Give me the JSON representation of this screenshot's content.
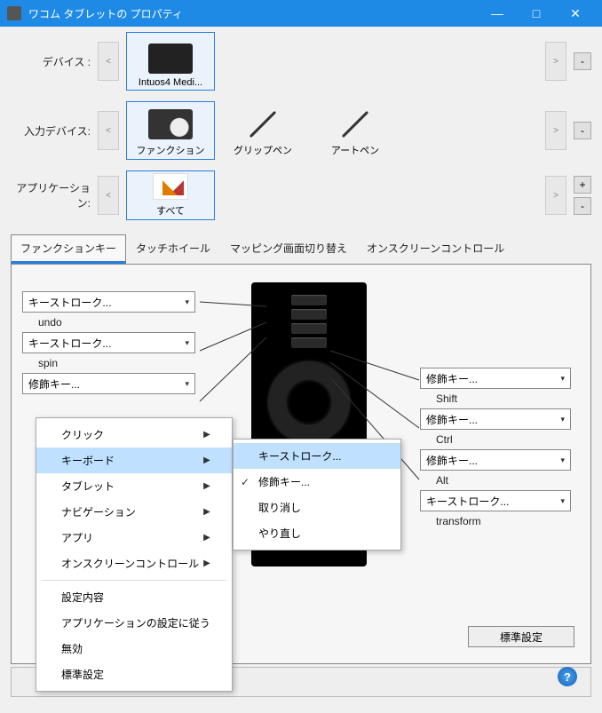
{
  "window": {
    "title": "ワコム タブレットの プロパティ",
    "min": "—",
    "max": "□",
    "close": "✕"
  },
  "sections": {
    "device_label": "デバイス :",
    "tool_label": "入力デバイス:",
    "app_label": "アプリケーション:"
  },
  "devices": [
    {
      "name": "Intuos4 Medi..."
    }
  ],
  "tools": [
    {
      "name": "ファンクション"
    },
    {
      "name": "グリップペン"
    },
    {
      "name": "アートペン"
    }
  ],
  "apps": [
    {
      "name": "すべて"
    }
  ],
  "tabs": [
    "ファンクションキー",
    "タッチホイール",
    "マッピング画面切り替え",
    "オンスクリーンコントロール"
  ],
  "left_combos": [
    {
      "value": "キーストローク...",
      "label": "undo"
    },
    {
      "value": "キーストローク...",
      "label": "spin"
    },
    {
      "value": "修飾キー...",
      "label": ""
    }
  ],
  "right_combos": [
    {
      "value": "修飾キー...",
      "label": "Shift"
    },
    {
      "value": "修飾キー...",
      "label": "Ctrl"
    },
    {
      "value": "修飾キー...",
      "label": "Alt"
    },
    {
      "value": "キーストローク...",
      "label": "transform"
    }
  ],
  "default_btn": "標準設定",
  "nav": {
    "prev": "<",
    "next": ">",
    "plus": "+",
    "minus": "-"
  },
  "ctx_main": [
    {
      "label": "クリック",
      "sub": true
    },
    {
      "label": "キーボード",
      "sub": true,
      "hl": true
    },
    {
      "label": "タブレット",
      "sub": true
    },
    {
      "label": "ナビゲーション",
      "sub": true
    },
    {
      "label": "アプリ",
      "sub": true
    },
    {
      "label": "オンスクリーンコントロール",
      "sub": true
    },
    {
      "sep": true
    },
    {
      "label": "設定内容"
    },
    {
      "label": "アプリケーションの設定に従う"
    },
    {
      "label": "無効"
    },
    {
      "label": "標準設定"
    }
  ],
  "ctx_sub": [
    {
      "label": "キーストローク...",
      "hl": true
    },
    {
      "label": "修飾キー...",
      "check": true
    },
    {
      "label": "取り消し"
    },
    {
      "label": "やり直し"
    }
  ],
  "help": "?"
}
